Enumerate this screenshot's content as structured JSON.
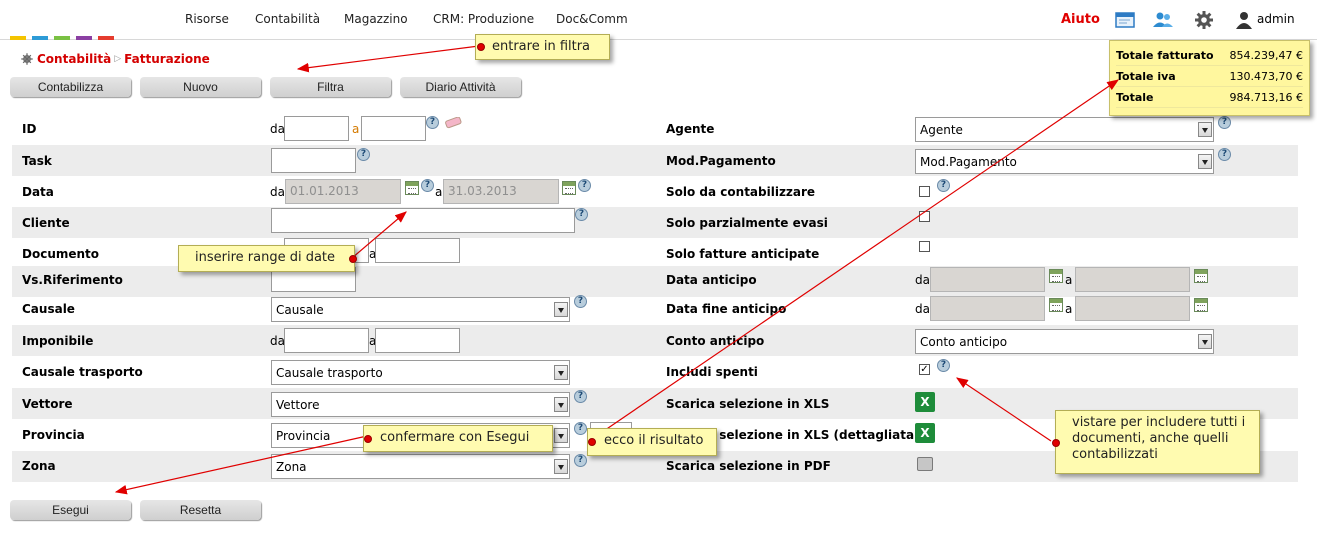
{
  "menu": [
    "Risorse",
    "Contabilità",
    "Magazzino",
    "CRM: Produzione",
    "Doc&Comm"
  ],
  "top_right": {
    "help": "Aiuto",
    "user": "admin"
  },
  "icons": {
    "window": "window-icon",
    "users": "users-icon",
    "settings": "gear-icon",
    "user": "user-icon"
  },
  "brand_colors": [
    "#f4c400",
    "#2d9bd6",
    "#7ac143",
    "#8b3fa3",
    "#e53c2e"
  ],
  "breadcrumb": {
    "section": "Contabilità",
    "page": "Fatturazione"
  },
  "toolbar": {
    "contabilizza": "Contabilizza",
    "nuovo": "Nuovo",
    "filtra": "Filtra",
    "diario": "Diario Attività"
  },
  "totals": [
    {
      "label": "Totale fatturato",
      "value": "854.239,47 €"
    },
    {
      "label": "Totale iva",
      "value": "130.473,70 €"
    },
    {
      "label": "Totale",
      "value": "984.713,16 €"
    }
  ],
  "left_fields": {
    "id": "ID",
    "task": "Task",
    "data": "Data",
    "cliente": "Cliente",
    "documento": "Documento",
    "vs_riferimento": "Vs.Riferimento",
    "causale": "Causale",
    "imponibile": "Imponibile",
    "causale_trasporto": "Causale trasporto",
    "vettore": "Vettore",
    "provincia": "Provincia",
    "zona": "Zona"
  },
  "range": {
    "da": "da",
    "a": "a"
  },
  "date_values": {
    "from": "01.01.2013",
    "to": "31.03.2013"
  },
  "selects": {
    "causale": "Causale",
    "causale_trasporto": "Causale trasporto",
    "vettore": "Vettore",
    "provincia": "Provincia",
    "zona": "Zona",
    "agente": "Agente",
    "mod_pagamento": "Mod.Pagamento",
    "conto_anticipo": "Conto anticipo"
  },
  "right_fields": {
    "agente": "Agente",
    "mod_pagamento": "Mod.Pagamento",
    "solo_contabilizzare": "Solo da contabilizzare",
    "solo_parziali": "Solo parzialmente evasi",
    "solo_anticipate": "Solo fatture anticipate",
    "data_anticipo": "Data anticipo",
    "data_fine_anticipo": "Data fine anticipo",
    "conto_anticipo": "Conto anticipo",
    "includi_spenti": "Includi spenti",
    "scarica_xls": "Scarica selezione in XLS",
    "scarica_xls_det": "Scarica selezione in XLS (dettagliata)",
    "scarica_pdf": "Scarica selezione in PDF"
  },
  "checkboxes": {
    "includi_spenti": true,
    "solo_contabilizzare": false,
    "solo_parziali": false,
    "solo_anticipate": false
  },
  "bottom": {
    "esegui": "Esegui",
    "resetta": "Resetta"
  },
  "callouts": {
    "filtra": "entrare in filtra",
    "date": "inserire range di date",
    "esegui": "confermare con Esegui",
    "risultato": "ecco il risultato",
    "spenti": "vistare per includere tutti i documenti, anche quelli contabilizzati"
  }
}
